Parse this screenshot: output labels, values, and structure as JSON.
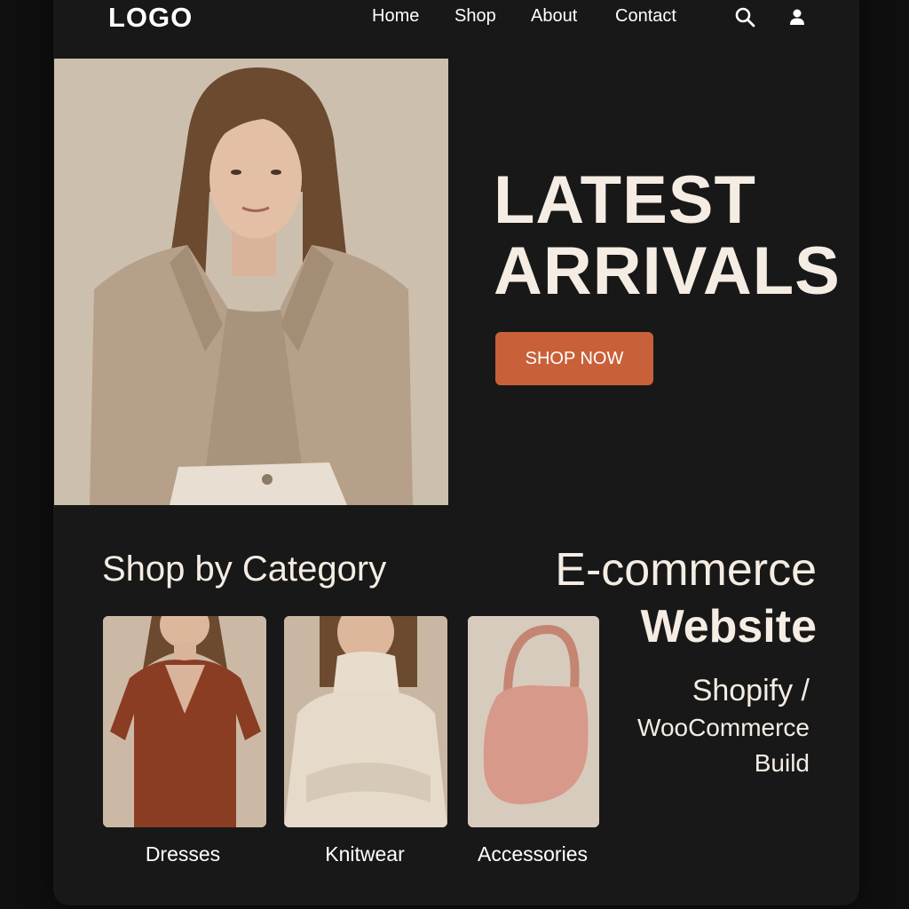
{
  "header": {
    "logo": "LOGO",
    "nav": [
      "Home",
      "Shop",
      "About",
      "Contact"
    ],
    "icons": [
      "search-icon",
      "user-icon"
    ]
  },
  "hero": {
    "title_line1": "LATEST",
    "title_line2": "ARRIVALS",
    "cta_label": "SHOP NOW",
    "accent_color": "#c8603a"
  },
  "categories": {
    "heading": "Shop by Category",
    "items": [
      {
        "label": "Dresses"
      },
      {
        "label": "Knitwear"
      },
      {
        "label": "Accessories"
      }
    ]
  },
  "promo": {
    "title_line1": "E-commerce",
    "title_line2": "Website",
    "sub_line1": "Shopify /",
    "sub_line2": "WooCommerce",
    "sub_line3": "Build"
  }
}
